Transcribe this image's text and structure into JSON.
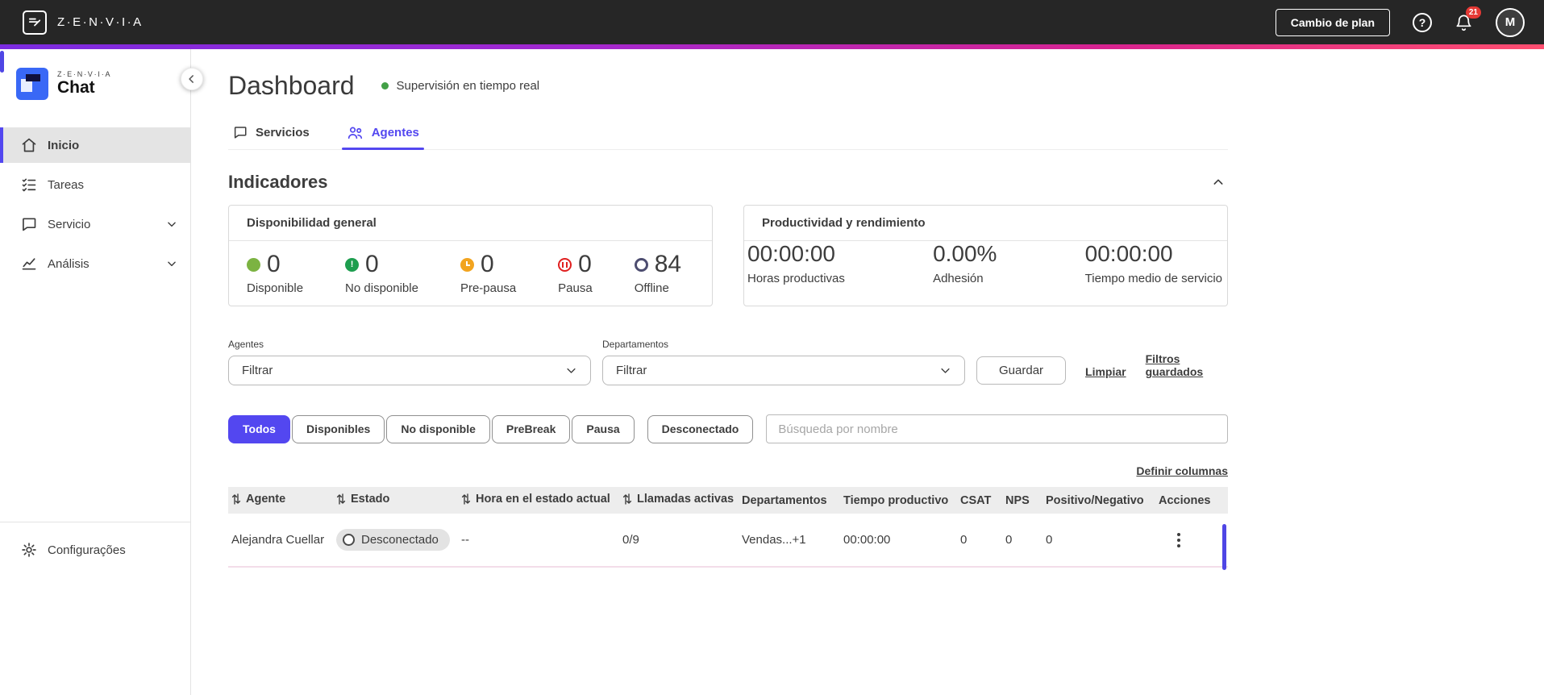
{
  "colors": {
    "accent": "#5347f0",
    "topbar_bg": "#262626",
    "available_green": "#7cb342",
    "unavailable_green": "#1e9e4f",
    "prebreak_orange": "#f2a41f",
    "pause_red": "#e02020",
    "offline_ring": "#4d4d70",
    "badge_red": "#e53935",
    "gradient": [
      "#7b2be0",
      "#a428cf",
      "#d8238f",
      "#ff4e6f"
    ]
  },
  "topbar": {
    "brand": "Z·E·N·V·I·A",
    "change_plan_button": "Cambio de plan",
    "help_glyph": "?",
    "notification_count": "21",
    "avatar_initial": "M"
  },
  "sidebar": {
    "logo_brand": "Z·E·N·V·I·A",
    "logo_product": "Chat",
    "items": [
      {
        "label": "Inicio"
      },
      {
        "label": "Tareas"
      },
      {
        "label": "Servicio"
      },
      {
        "label": "Análisis"
      }
    ],
    "footer": {
      "label": "Configurações"
    }
  },
  "header": {
    "title": "Dashboard",
    "realtime_label": "Supervisión en tiempo real"
  },
  "tabs": [
    {
      "label": "Servicios"
    },
    {
      "label": "Agentes"
    }
  ],
  "indicators": {
    "title": "Indicadores",
    "availability_card": {
      "title": "Disponibilidad general",
      "stats": [
        {
          "label": "Disponible",
          "value": "0"
        },
        {
          "label": "No disponible",
          "value": "0"
        },
        {
          "label": "Pre-pausa",
          "value": "0"
        },
        {
          "label": "Pausa",
          "value": "0"
        },
        {
          "label": "Offline",
          "value": "84"
        }
      ]
    },
    "productivity_card": {
      "title": "Productividad y rendimiento",
      "stats": [
        {
          "label": "Horas productivas",
          "value": "00:00:00"
        },
        {
          "label": "Adhesión",
          "value": "0.00%"
        },
        {
          "label": "Tiempo medio de servicio",
          "value": "00:00:00"
        }
      ]
    }
  },
  "filters": {
    "agents": {
      "label": "Agentes",
      "value": "Filtrar"
    },
    "departments": {
      "label": "Departamentos",
      "value": "Filtrar"
    },
    "save_button": "Guardar",
    "clear_link": "Limpiar",
    "saved_filters_link": "Filtros guardados"
  },
  "status_filters": [
    {
      "label": "Todos"
    },
    {
      "label": "Disponibles"
    },
    {
      "label": "No disponible"
    },
    {
      "label": "PreBreak"
    },
    {
      "label": "Pausa"
    },
    {
      "label": "Desconectado"
    }
  ],
  "search": {
    "placeholder": "Búsqueda por nombre"
  },
  "table": {
    "define_columns_link": "Definir columnas",
    "columns": [
      {
        "label": "Agente",
        "sortable": true
      },
      {
        "label": "Estado",
        "sortable": true
      },
      {
        "label": "Hora en el estado actual",
        "sortable": true
      },
      {
        "label": "Llamadas activas",
        "sortable": true
      },
      {
        "label": "Departamentos",
        "sortable": false
      },
      {
        "label": "Tiempo productivo",
        "sortable": false
      },
      {
        "label": "CSAT",
        "sortable": false
      },
      {
        "label": "NPS",
        "sortable": false
      },
      {
        "label": "Positivo/Negativo",
        "sortable": false
      },
      {
        "label": "Acciones",
        "sortable": false
      }
    ],
    "rows": [
      {
        "agent": "Alejandra Cuellar",
        "status": "Desconectado",
        "time_in_status": "--",
        "active_calls": "0/9",
        "departments": "Vendas...+1",
        "productive_time": "00:00:00",
        "csat": "0",
        "nps": "0",
        "positive_negative": "0"
      }
    ]
  }
}
